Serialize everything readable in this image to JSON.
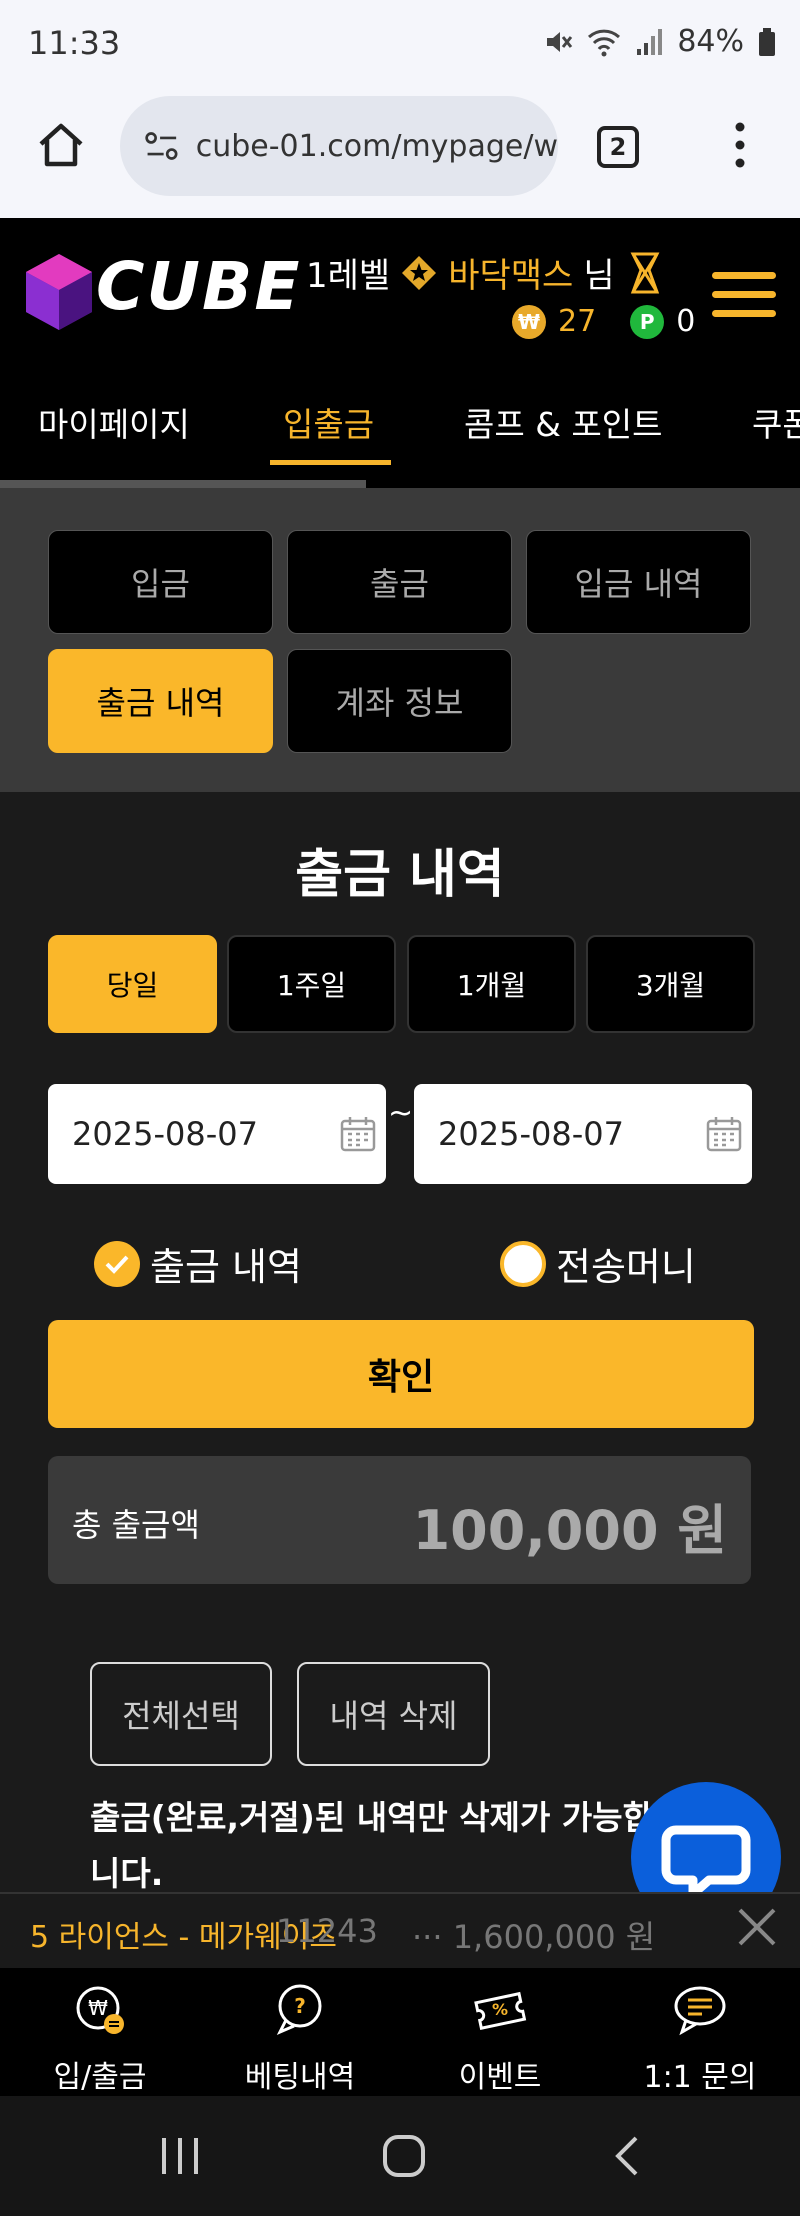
{
  "status_bar": {
    "time": "11:33",
    "battery": "84%"
  },
  "browser": {
    "url": "cube-01.com/mypage/w",
    "tab_count": "2"
  },
  "header": {
    "logo_text": "CUBE",
    "level": "1레벨",
    "username": "바닥맥스",
    "honorific": "님",
    "coins": "27",
    "points": "0"
  },
  "nav": {
    "items": [
      "마이페이지",
      "입출금",
      "콤프 & 포인트",
      "쿠폰"
    ],
    "active": "입출금"
  },
  "subtabs": {
    "items": [
      "입금",
      "출금",
      "입금 내역",
      "출금 내역",
      "계좌 정보"
    ],
    "active": "출금 내역"
  },
  "content": {
    "title": "출금 내역",
    "periods": [
      "당일",
      "1주일",
      "1개월",
      "3개월"
    ],
    "active_period": "당일",
    "date_from": "2025-08-07",
    "date_to": "2025-08-07",
    "date_separator": "~",
    "radio_withdrawal": "출금 내역",
    "radio_transfer": "전송머니",
    "confirm_label": "확인",
    "total_label": "총 출금액",
    "total_amount": "100,000 원",
    "select_all_label": "전체선택",
    "delete_label": "내역 삭제",
    "notice": "출금(완료,거절)된 내역만 삭제가 가능합니다."
  },
  "ticker": {
    "text1": "5 라이언스 - 메가웨이즈",
    "text2": "11243",
    "text3": "··· 1,600,000 원"
  },
  "bottom_nav": [
    {
      "label": "입/출금",
      "icon": "won-exchange-icon"
    },
    {
      "label": "베팅내역",
      "icon": "question-chat-icon"
    },
    {
      "label": "이벤트",
      "icon": "ticket-icon"
    },
    {
      "label": "1:1 문의",
      "icon": "message-icon"
    }
  ],
  "colors": {
    "accent": "#fab72a",
    "bg": "#1b1b1b",
    "chat": "#0b5fdb"
  }
}
